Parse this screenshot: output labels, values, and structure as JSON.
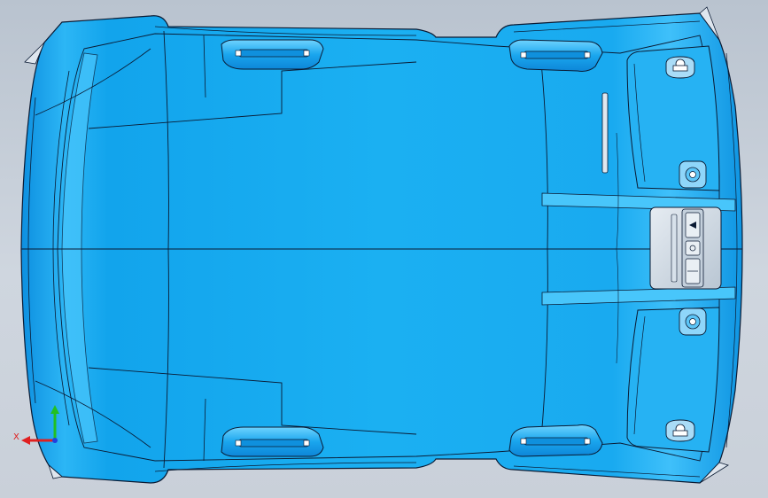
{
  "viewport": {
    "background": "#c4ccd6",
    "part_color": "#1aaef0",
    "part_highlight": "#4fc8ff",
    "part_shadow": "#0b7fcf",
    "edge_color": "#0a1a33"
  },
  "triad": {
    "x_label": "X",
    "x_color": "#e02020",
    "y_color": "#22c022",
    "z_color": "#2040e0"
  },
  "model": {
    "type": "headliner-panel",
    "console_icon": "overhead-console"
  }
}
